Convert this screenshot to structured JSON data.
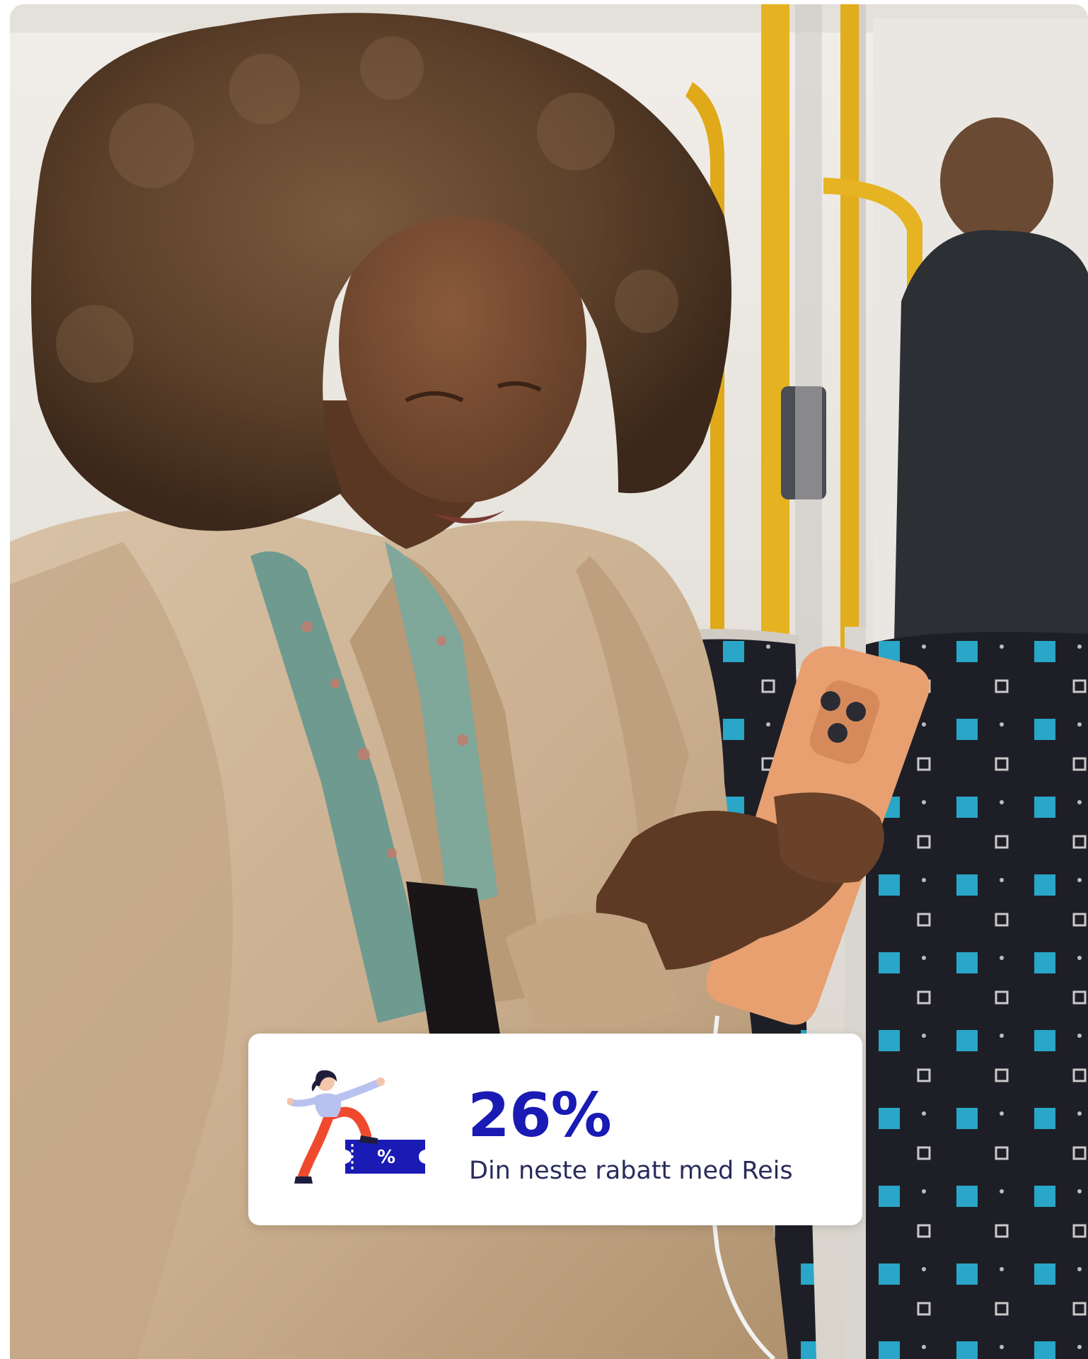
{
  "promo": {
    "value": "26%",
    "caption": "Din neste rabatt med Reis",
    "accent_color": "#1a1ab4",
    "illustration_icon": "person-on-discount-ticket-icon"
  },
  "photo": {
    "subject": "woman-using-phone-on-bus-photo"
  }
}
